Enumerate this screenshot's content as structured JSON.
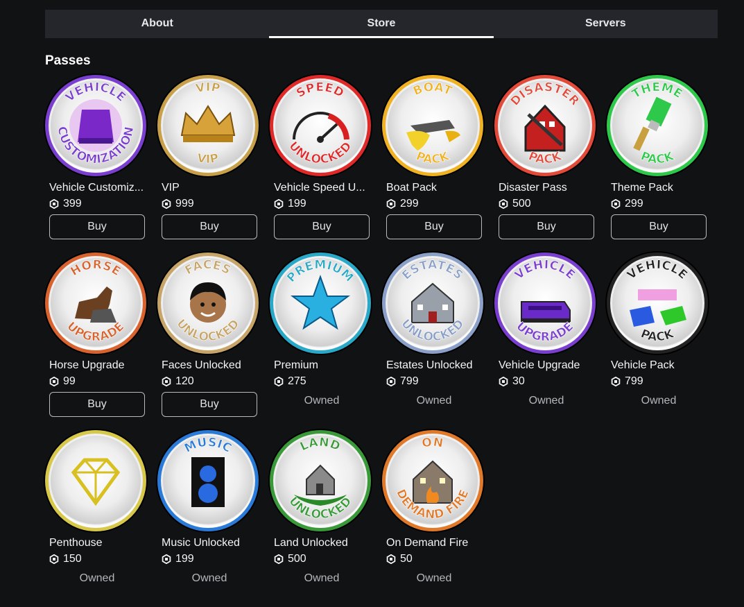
{
  "tabs": [
    {
      "label": "About",
      "active": false
    },
    {
      "label": "Store",
      "active": true
    },
    {
      "label": "Servers",
      "active": false
    }
  ],
  "section_title": "Passes",
  "passes": [
    {
      "name": "Vehicle Customiz...",
      "price": "399",
      "action": "Buy",
      "top": "VEHICLE",
      "bottom": "CUSTOMIZATION",
      "ring": "#7b3fd0",
      "art": "purple-cup-icon"
    },
    {
      "name": "VIP",
      "price": "999",
      "action": "Buy",
      "top": "VIP",
      "bottom": "VIP",
      "ring": "#c9a04a",
      "art": "crown-icon"
    },
    {
      "name": "Vehicle Speed U...",
      "price": "199",
      "action": "Buy",
      "top": "SPEED",
      "bottom": "UNLOCKED",
      "ring": "#e02a2a",
      "art": "speedometer-icon"
    },
    {
      "name": "Boat Pack",
      "price": "299",
      "action": "Buy",
      "top": "BOAT",
      "bottom": "PACK",
      "ring": "#f0b223",
      "art": "boat-icon"
    },
    {
      "name": "Disaster Pass",
      "price": "500",
      "action": "Buy",
      "top": "DISASTER",
      "bottom": "PACK",
      "ring": "#e24a3a",
      "art": "broken-house-icon"
    },
    {
      "name": "Theme Pack",
      "price": "299",
      "action": "Buy",
      "top": "THEME",
      "bottom": "PACK",
      "ring": "#2ec84a",
      "art": "paint-brush-icon"
    },
    {
      "name": "Horse Upgrade",
      "price": "99",
      "action": "Buy",
      "top": "HORSE",
      "bottom": "UPGRADE",
      "ring": "#d8632e",
      "art": "horse-icon"
    },
    {
      "name": "Faces Unlocked",
      "price": "120",
      "action": "Buy",
      "top": "FACES",
      "bottom": "UNLOCKED",
      "ring": "#c7a569",
      "art": "face-icon"
    },
    {
      "name": "Premium",
      "price": "275",
      "action": "Owned",
      "top": "PREMIUM",
      "bottom": "",
      "ring": "#2aa8c8",
      "art": "star-icon"
    },
    {
      "name": "Estates Unlocked",
      "price": "799",
      "action": "Owned",
      "top": "ESTATES",
      "bottom": "UNLOCKED",
      "ring": "#8aa0c8",
      "art": "mansion-icon"
    },
    {
      "name": "Vehicle Upgrade",
      "price": "30",
      "action": "Owned",
      "top": "VEHICLE",
      "bottom": "UPGRADE",
      "ring": "#7b3fd0",
      "art": "purple-car-icon"
    },
    {
      "name": "Vehicle Pack",
      "price": "799",
      "action": "Owned",
      "top": "VEHICLE",
      "bottom": "PACK",
      "ring": "#222222",
      "art": "cars-icon"
    },
    {
      "name": "Penthouse",
      "price": "150",
      "action": "Owned",
      "top": "",
      "bottom": "",
      "ring": "#d8c84a",
      "art": "diamond-icon"
    },
    {
      "name": "Music Unlocked",
      "price": "199",
      "action": "Owned",
      "top": "MUSIC",
      "bottom": "",
      "ring": "#2a7ad8",
      "art": "speaker-icon"
    },
    {
      "name": "Land Unlocked",
      "price": "500",
      "action": "Owned",
      "top": "LAND",
      "bottom": "UNLOCKED",
      "ring": "#3a9a3a",
      "art": "island-house-icon"
    },
    {
      "name": "On Demand Fire",
      "price": "50",
      "action": "Owned",
      "top": "ON",
      "bottom": "DEMAND FIRE",
      "ring": "#e07a2a",
      "art": "house-fire-icon"
    }
  ]
}
